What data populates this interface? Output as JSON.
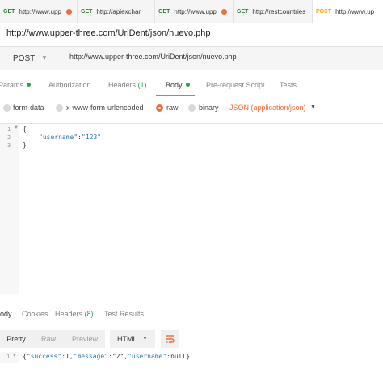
{
  "request_tabs": [
    {
      "method": "GET",
      "url": "http://www.upp",
      "modified": true
    },
    {
      "method": "GET",
      "url": "http://apiexchar",
      "modified": false
    },
    {
      "method": "GET",
      "url": "http://www.upp",
      "modified": true
    },
    {
      "method": "GET",
      "url": "http://restcountries",
      "modified": false
    },
    {
      "method": "POST",
      "url": "http://www.up",
      "modified": false,
      "active": true
    }
  ],
  "request_title": "http://www.upper-three.com/UriDent/json/nuevo.php",
  "request_bar": {
    "method": "POST",
    "url": "http://www.upper-three.com/UriDent/json/nuevo.php"
  },
  "subtabs": {
    "params": "Params",
    "authorization": "Authorization",
    "headers": "Headers",
    "headers_count": "(1)",
    "body": "Body",
    "prerequest": "Pre-request Script",
    "tests": "Tests",
    "active": "Body"
  },
  "body_modes": {
    "form_data": "form-data",
    "urlencoded": "x-www-form-urlencoded",
    "raw": "raw",
    "binary": "binary",
    "selected": "raw",
    "content_type": "JSON (application/json)"
  },
  "editor": {
    "lines": [
      {
        "num": "1",
        "open": "{"
      },
      {
        "num": "2",
        "key": "\"username\"",
        "colon": ":",
        "value": "\"123\""
      },
      {
        "num": "3",
        "close": "}"
      }
    ]
  },
  "response": {
    "tabs": {
      "body": "ody",
      "cookies": "Cookies",
      "headers": "Headers",
      "headers_count": "(8)",
      "test_results": "Test Results"
    },
    "views": {
      "pretty": "Pretty",
      "raw": "Raw",
      "preview": "Preview"
    },
    "format": "HTML",
    "line_num": "1",
    "text": {
      "open": "{",
      "k1": "\"success\"",
      "v1": ":1,",
      "k2": "\"message\"",
      "v2": ":\"2\",",
      "k3": "\"username\"",
      "v3": ":null}"
    }
  },
  "colors": {
    "accent": "#f26b3a",
    "get": "#2e7d32",
    "post": "#f2a900",
    "green": "#2a9d5a"
  }
}
